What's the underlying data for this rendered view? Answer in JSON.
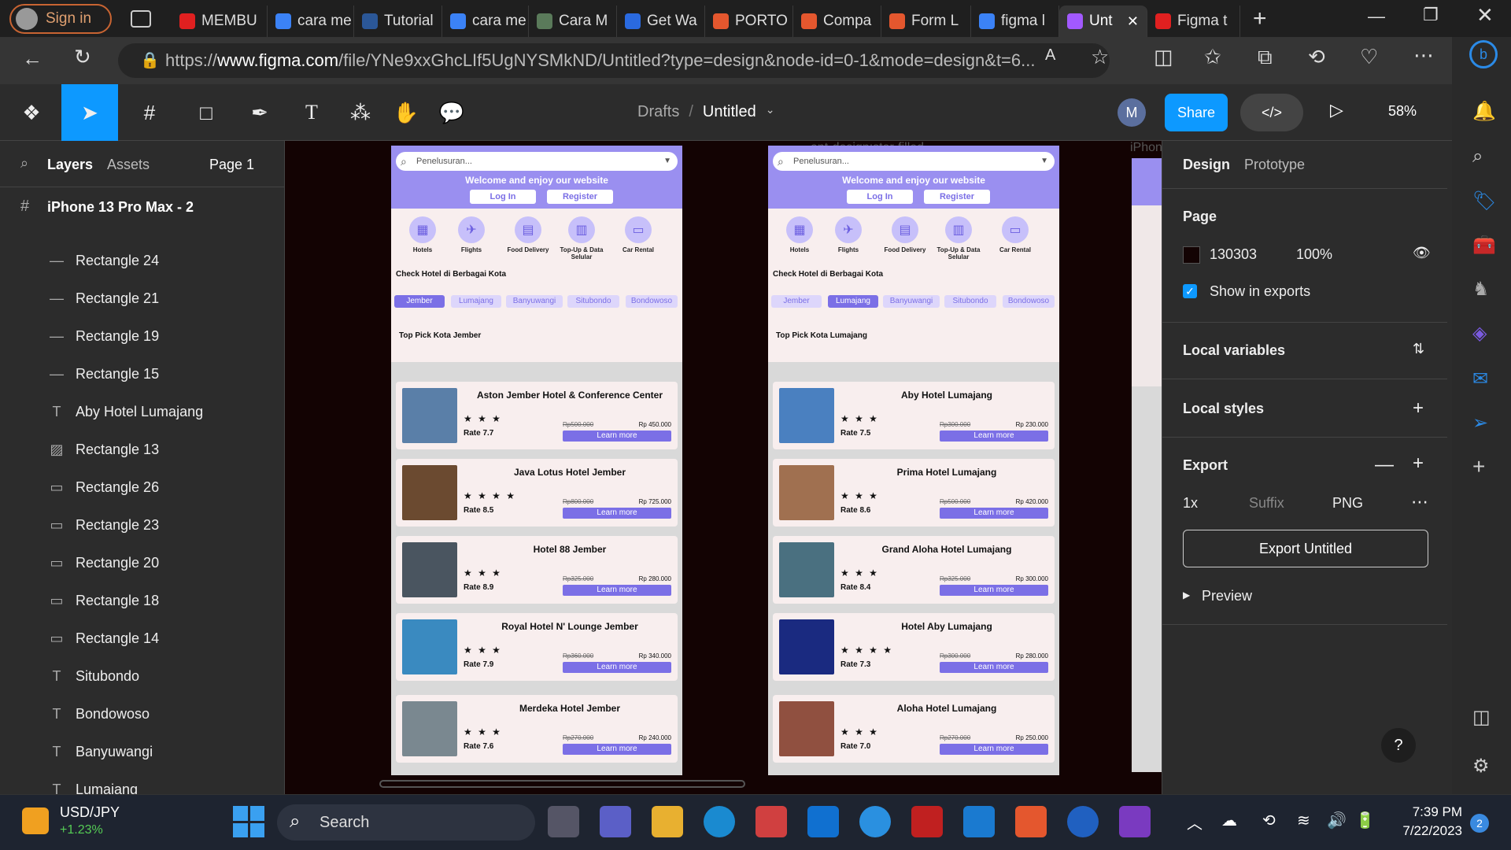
{
  "browser": {
    "signin_label": "Sign in",
    "tabs": [
      {
        "label": "MEMBU",
        "color": "#e02020"
      },
      {
        "label": "cara me",
        "color": "#3b82f6"
      },
      {
        "label": "Tutorial",
        "color": "#2b5797"
      },
      {
        "label": "cara me",
        "color": "#3b82f6"
      },
      {
        "label": "Cara M",
        "color": "#5a7a5a"
      },
      {
        "label": "Get Wa",
        "color": "#2a6ae0"
      },
      {
        "label": "PORTO",
        "color": "#e4572e"
      },
      {
        "label": "Compa",
        "color": "#e4572e"
      },
      {
        "label": "Form L",
        "color": "#e4572e"
      },
      {
        "label": "figma l",
        "color": "#3b82f6"
      },
      {
        "label": "Unt",
        "color": "#a259ff"
      },
      {
        "label": "Figma t",
        "color": "#e02020"
      }
    ],
    "url_prefix": "https://",
    "url_host": "www.figma.com",
    "url_path": "/file/YNe9xxGhcLIf5UgNYSMkND/Untitled?type=design&node-id=0-1&mode=design&t=6..."
  },
  "figma": {
    "breadcrumb_drafts": "Drafts",
    "breadcrumb_sep": "/",
    "file_name": "Untitled",
    "avatar_initial": "M",
    "share_label": "Share",
    "zoom": "58%",
    "left_tabs": {
      "layers": "Layers",
      "assets": "Assets",
      "page": "Page 1"
    },
    "frame_name": "iPhone 13 Pro Max - 2",
    "layers": [
      {
        "icon": "—",
        "name": "Rectangle 24"
      },
      {
        "icon": "—",
        "name": "Rectangle 21"
      },
      {
        "icon": "—",
        "name": "Rectangle 19"
      },
      {
        "icon": "—",
        "name": "Rectangle 15"
      },
      {
        "icon": "T",
        "name": "Aby Hotel Lumajang"
      },
      {
        "icon": "▨",
        "name": "Rectangle 13"
      },
      {
        "icon": "▭",
        "name": "Rectangle 26"
      },
      {
        "icon": "▭",
        "name": "Rectangle 23"
      },
      {
        "icon": "▭",
        "name": "Rectangle 20"
      },
      {
        "icon": "▭",
        "name": "Rectangle 18"
      },
      {
        "icon": "▭",
        "name": "Rectangle 14"
      },
      {
        "icon": "T",
        "name": "Situbondo"
      },
      {
        "icon": "T",
        "name": "Bondowoso"
      },
      {
        "icon": "T",
        "name": "Banyuwangi"
      },
      {
        "icon": "T",
        "name": "Lumajang"
      }
    ],
    "right": {
      "tab_design": "Design",
      "tab_prototype": "Prototype",
      "page_title": "Page",
      "page_color": "130303",
      "page_opacity": "100%",
      "show_exports": "Show in exports",
      "local_variables": "Local variables",
      "local_styles": "Local styles",
      "export_title": "Export",
      "export_scale": "1x",
      "export_suffix": "Suffix",
      "export_format": "PNG",
      "export_button": "Export Untitled",
      "preview": "Preview"
    },
    "canvas_label": "ant-design:star-filled",
    "canvas_label_right": "iPhon"
  },
  "phones": [
    {
      "search": "Penelusuran...",
      "welcome": "Welcome and enjoy our website",
      "login": "Log In",
      "register": "Register",
      "categories": [
        "Hotels",
        "Flights",
        "Food Delivery",
        "Top-Up & Data Selular",
        "Car Rental"
      ],
      "check": "Check Hotel di Berbagai Kota",
      "cities": [
        "Jember",
        "Lumajang",
        "Banyuwangi",
        "Situbondo",
        "Bondowoso"
      ],
      "active_city": 0,
      "top_pick": "Top Pick Kota Jember",
      "hotels": [
        {
          "name": "Aston Jember Hotel & Conference Center",
          "stars": "★ ★ ★",
          "rate": "Rate 7.7",
          "old": "Rp500.000",
          "price": "Rp 450.000",
          "btn": "Learn more",
          "img": "#5a7fa8"
        },
        {
          "name": "Java Lotus Hotel Jember",
          "stars": "★ ★ ★ ★",
          "rate": "Rate 8.5",
          "old": "Rp800.000",
          "price": "Rp 725.000",
          "btn": "Learn more",
          "img": "#6b4a30"
        },
        {
          "name": "Hotel 88 Jember",
          "stars": "★ ★ ★",
          "rate": "Rate 8.9",
          "old": "Rp325.000",
          "price": "Rp 280.000",
          "btn": "Learn more",
          "img": "#4a5560"
        },
        {
          "name": "Royal Hotel N' Lounge Jember",
          "stars": "★ ★ ★",
          "rate": "Rate 7.9",
          "old": "Rp360.000",
          "price": "Rp 340.000",
          "btn": "Learn more",
          "img": "#3a8ac0"
        },
        {
          "name": "Merdeka Hotel Jember",
          "stars": "★ ★ ★",
          "rate": "Rate 7.6",
          "old": "Rp270.000",
          "price": "Rp 240.000",
          "btn": "Learn more",
          "img": "#7a8890"
        }
      ]
    },
    {
      "search": "Penelusuran...",
      "welcome": "Welcome and enjoy our website",
      "login": "Log In",
      "register": "Register",
      "categories": [
        "Hotels",
        "Flights",
        "Food Delivery",
        "Top-Up & Data Selular",
        "Car Rental"
      ],
      "check": "Check Hotel di Berbagai Kota",
      "cities": [
        "Jember",
        "Lumajang",
        "Banyuwangi",
        "Situbondo",
        "Bondowoso"
      ],
      "active_city": 1,
      "top_pick": "Top Pick Kota Lumajang",
      "hotels": [
        {
          "name": "Aby Hotel Lumajang",
          "stars": "★ ★ ★",
          "rate": "Rate 7.5",
          "old": "Rp300.000",
          "price": "Rp 230.000",
          "btn": "Learn more",
          "img": "#4a80c0"
        },
        {
          "name": "Prima Hotel Lumajang",
          "stars": "★ ★ ★",
          "rate": "Rate 8.6",
          "old": "Rp500.000",
          "price": "Rp 420.000",
          "btn": "Learn more",
          "img": "#a07050"
        },
        {
          "name": "Grand Aloha Hotel Lumajang",
          "stars": "★ ★ ★",
          "rate": "Rate 8.4",
          "old": "Rp325.000",
          "price": "Rp 300.000",
          "btn": "Learn more",
          "img": "#4a7080"
        },
        {
          "name": "Hotel Aby Lumajang",
          "stars": "★ ★ ★ ★",
          "rate": "Rate 7.3",
          "old": "Rp300.000",
          "price": "Rp 280.000",
          "btn": "Learn more",
          "img": "#1a2a80"
        },
        {
          "name": "Aloha Hotel Lumajang",
          "stars": "★ ★ ★",
          "rate": "Rate 7.0",
          "old": "Rp270.000",
          "price": "Rp 250.000",
          "btn": "Learn more",
          "img": "#905040"
        }
      ]
    }
  ],
  "taskbar": {
    "widget_title": "USD/JPY",
    "widget_value": "+1.23%",
    "search": "Search",
    "time": "7:39 PM",
    "date": "7/22/2023",
    "badge": "2"
  },
  "colors": {
    "accent": "#0d99ff",
    "purple": "#7b6fe6",
    "canvas": "#130303"
  }
}
